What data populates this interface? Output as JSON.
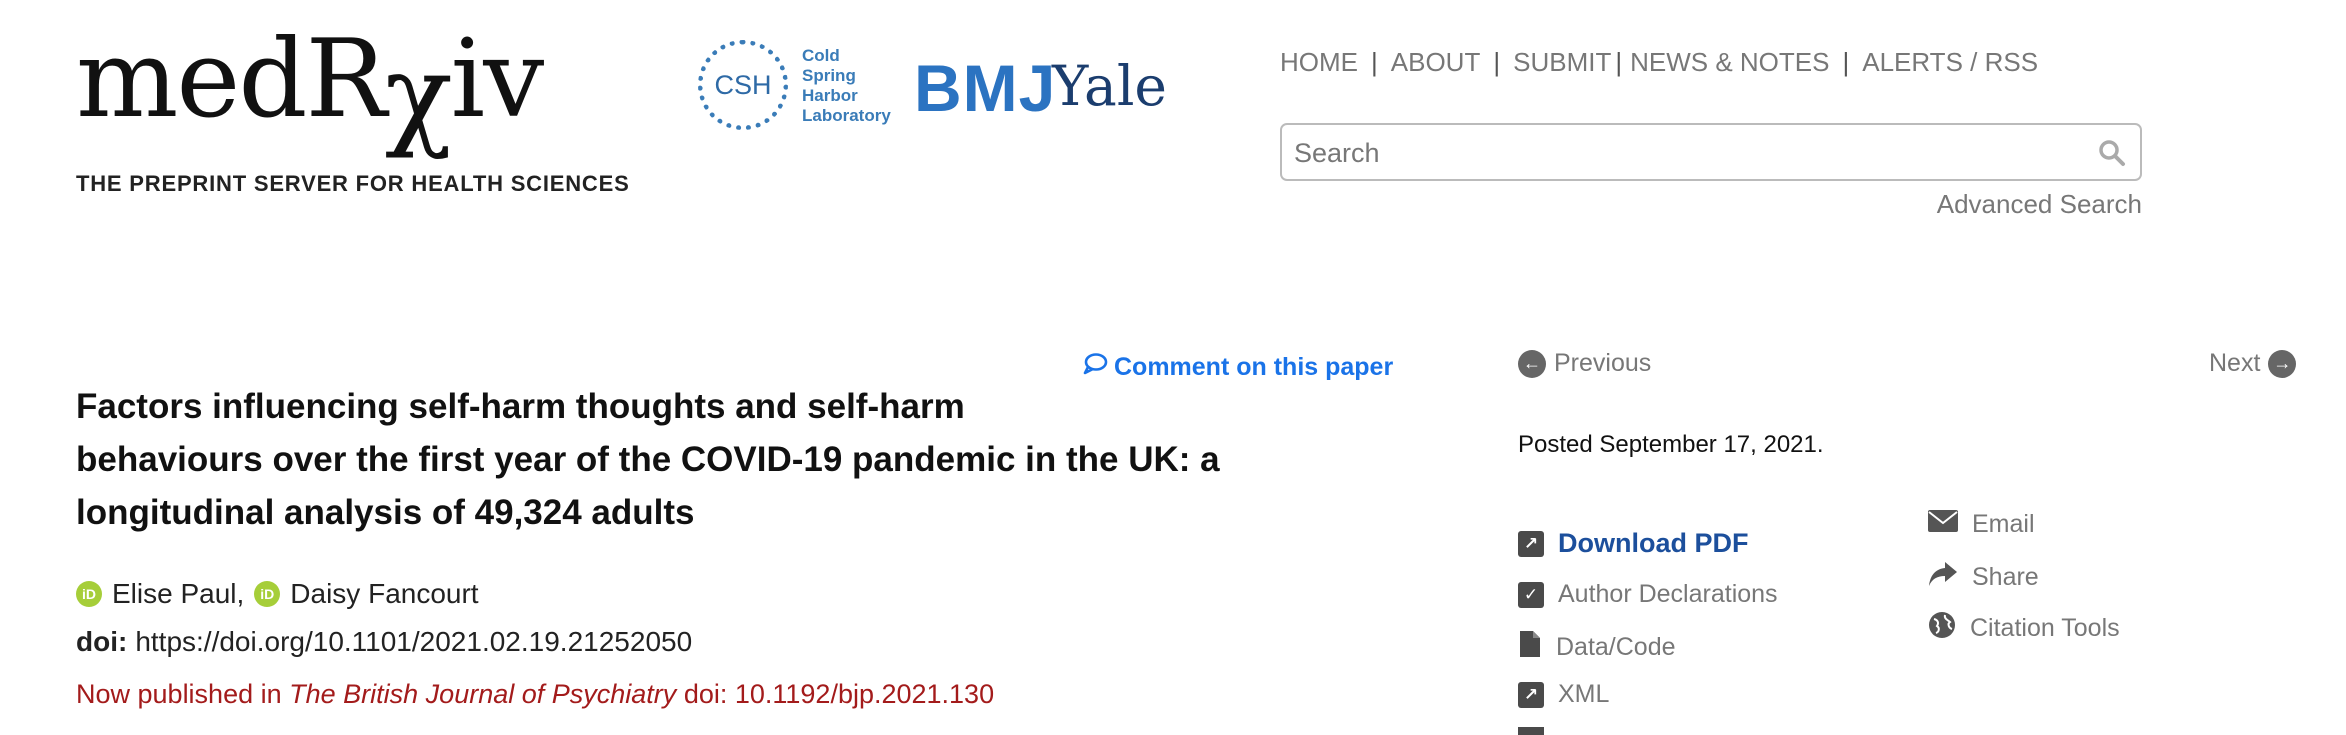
{
  "header": {
    "logo_main": "medR",
    "logo_chi": "χ",
    "logo_end": "iv",
    "tagline": "THE PREPRINT SERVER FOR HEALTH SCIENCES",
    "csh_mark": "CSH",
    "csh_text": "Cold\nSpring\nHarbor\nLaboratory",
    "bmj": "BMJ",
    "yale": "Yale"
  },
  "nav": {
    "items": [
      "HOME",
      "ABOUT",
      "SUBMIT",
      "NEWS & NOTES",
      "ALERTS / RSS"
    ],
    "sep": "|"
  },
  "search": {
    "placeholder": "Search",
    "advanced": "Advanced Search"
  },
  "comment_link": "Comment on this paper",
  "article": {
    "title_lines": [
      "Factors influencing self-harm thoughts and self-harm",
      "behaviours over the first year of the COVID-19 pandemic in the UK: a",
      "longitudinal analysis of 49,324 adults"
    ],
    "authors": [
      "Elise Paul,",
      "Daisy Fancourt"
    ],
    "doi_label": "doi:",
    "doi": "https://doi.org/10.1101/2021.02.19.21252050",
    "published_prefix": "Now published in",
    "published_journal": "The British Journal of Psychiatry",
    "published_doi": "doi: 10.1192/bjp.2021.130"
  },
  "sidebar": {
    "previous": "Previous",
    "next": "Next",
    "posted": "Posted September 17, 2021.",
    "download_pdf": "Download PDF",
    "author_declarations": "Author Declarations",
    "data_code": "Data/Code",
    "xml": "XML",
    "email": "Email",
    "share": "Share",
    "citation_tools": "Citation Tools"
  },
  "colors": {
    "brand_blue": "#2b5c9a",
    "link_blue": "#1a73e8",
    "pdf_blue": "#1c4f9c",
    "published_red": "#a31b1b",
    "orcid_green": "#a6ce39"
  }
}
